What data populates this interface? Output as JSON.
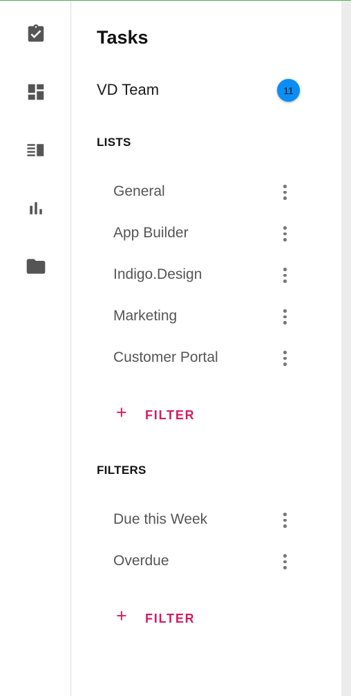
{
  "nav_rail": {
    "items": [
      {
        "icon": "clipboard-check-icon"
      },
      {
        "icon": "dashboard-icon"
      },
      {
        "icon": "view-list-icon"
      },
      {
        "icon": "bar-chart-icon"
      },
      {
        "icon": "folder-icon"
      }
    ]
  },
  "panel": {
    "title": "Tasks",
    "team": {
      "name": "VD Team",
      "count": "11"
    },
    "lists": {
      "header": "LISTS",
      "items": [
        {
          "label": "General"
        },
        {
          "label": "App Builder"
        },
        {
          "label": "Indigo.Design"
        },
        {
          "label": "Marketing"
        },
        {
          "label": "Customer Portal"
        }
      ],
      "add_label": "FILTER",
      "add_icon": "+"
    },
    "filters": {
      "header": "FILTERS",
      "items": [
        {
          "label": "Due this Week"
        },
        {
          "label": "Overdue"
        }
      ],
      "add_label": "FILTER",
      "add_icon": "+"
    }
  },
  "colors": {
    "accent": "#d81b60",
    "badge": "#0a8ef5",
    "icon": "#555555",
    "top_border": "#4caf50"
  }
}
